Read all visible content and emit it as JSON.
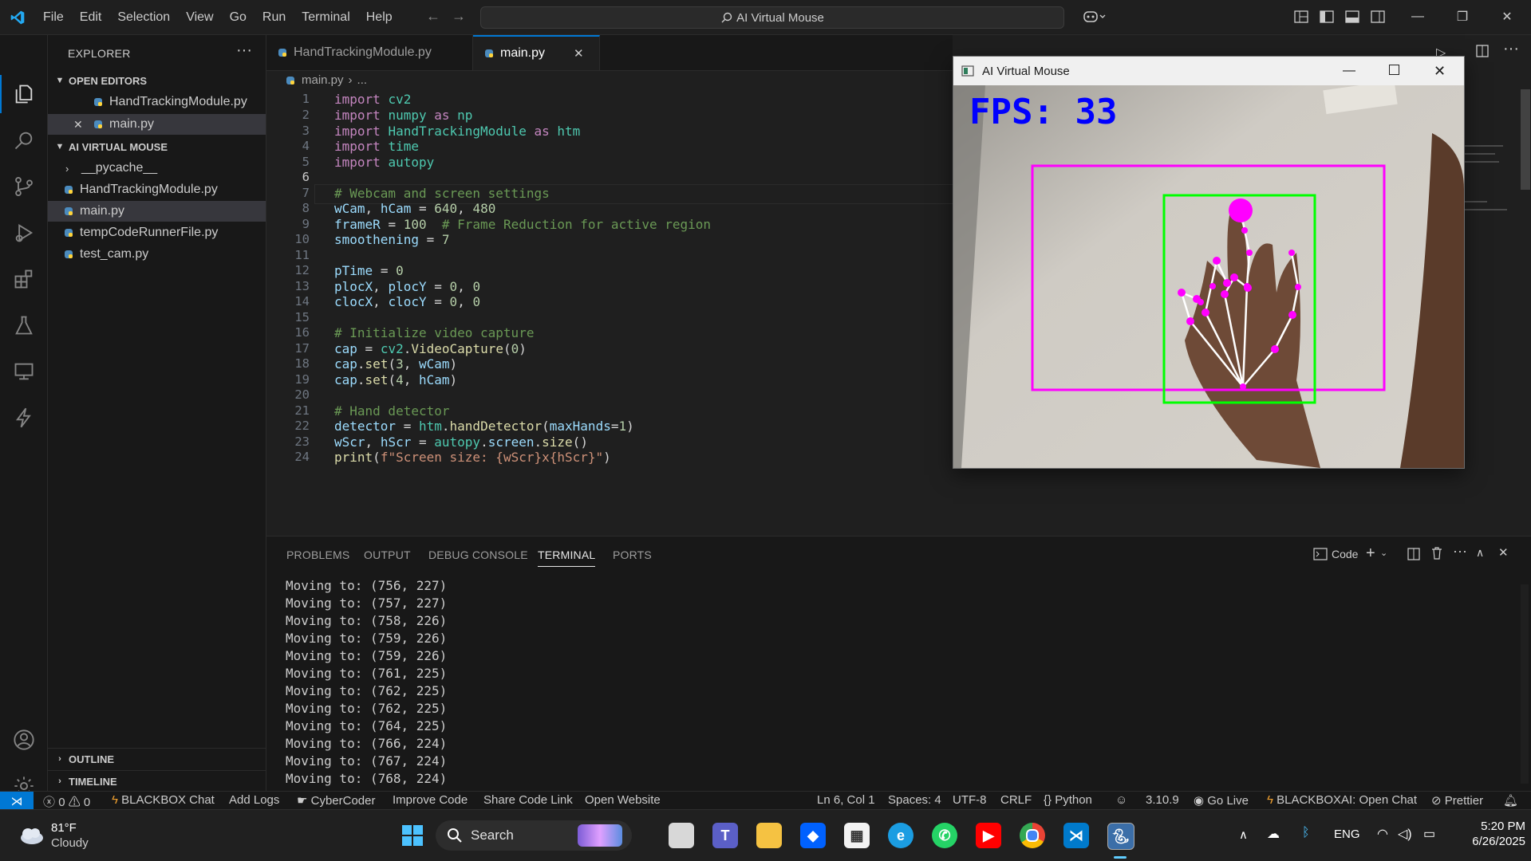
{
  "window": {
    "search_text": "AI Virtual Mouse"
  },
  "menu": [
    "File",
    "Edit",
    "Selection",
    "View",
    "Go",
    "Run",
    "Terminal",
    "Help"
  ],
  "sidebar": {
    "title": "EXPLORER",
    "open_editors_label": "OPEN EDITORS",
    "open_editors": [
      "HandTrackingModule.py",
      "main.py"
    ],
    "project_label": "AI VIRTUAL MOUSE",
    "files": [
      "__pycache__",
      "HandTrackingModule.py",
      "main.py",
      "tempCodeRunnerFile.py",
      "test_cam.py"
    ],
    "outline_label": "OUTLINE",
    "timeline_label": "TIMELINE"
  },
  "tabs": [
    {
      "label": "HandTrackingModule.py"
    },
    {
      "label": "main.py"
    }
  ],
  "breadcrumb": {
    "file": "main.py",
    "rest": "..."
  },
  "editor": {
    "line_numbers": [
      "1",
      "2",
      "3",
      "4",
      "5",
      "6",
      "7",
      "8",
      "9",
      "10",
      "11",
      "12",
      "13",
      "14",
      "15",
      "16",
      "17",
      "18",
      "19",
      "20",
      "21",
      "22",
      "23",
      "24"
    ],
    "lines": [
      "import cv2",
      "import numpy as np",
      "import HandTrackingModule as htm",
      "import time",
      "import autopy",
      "",
      "# Webcam and screen settings",
      "wCam, hCam = 640, 480",
      "frameR = 100  # Frame Reduction for active region",
      "smoothening = 7",
      "",
      "pTime = 0",
      "plocX, plocY = 0, 0",
      "clocX, clocY = 0, 0",
      "",
      "# Initialize video capture",
      "cap = cv2.VideoCapture(0)",
      "cap.set(3, wCam)",
      "cap.set(4, hCam)",
      "",
      "# Hand detector",
      "detector = htm.handDetector(maxHands=1)",
      "wScr, hScr = autopy.screen.size()",
      "print(f\"Screen size: {wScr}x{hScr}\")"
    ]
  },
  "app_window": {
    "title": "AI Virtual Mouse",
    "fps_text": "FPS: 33"
  },
  "panel": {
    "tabs": [
      "PROBLEMS",
      "OUTPUT",
      "DEBUG CONSOLE",
      "TERMINAL",
      "PORTS"
    ],
    "terminal_profile": "Code",
    "terminal_lines": [
      "Moving to: (756, 227)",
      "Moving to: (757, 227)",
      "Moving to: (758, 226)",
      "Moving to: (759, 226)",
      "Moving to: (759, 226)",
      "Moving to: (761, 225)",
      "Moving to: (762, 225)",
      "Moving to: (762, 225)",
      "Moving to: (764, 225)",
      "Moving to: (766, 224)",
      "Moving to: (767, 224)",
      "Moving to: (768, 224)"
    ]
  },
  "statusbar": {
    "errors": "0",
    "warnings": "0",
    "left_items": [
      "BLACKBOX Chat",
      "Add Logs",
      "CyberCoder",
      "Improve Code",
      "Share Code Link",
      "Open Website"
    ],
    "position": "Ln 6, Col 1",
    "spaces": "Spaces: 4",
    "encoding": "UTF-8",
    "eol": "CRLF",
    "language": "Python",
    "python_version": "3.10.9",
    "go_live": "Go Live",
    "blackbox_open": "BLACKBOXAI: Open Chat",
    "prettier": "Prettier"
  },
  "taskbar": {
    "weather_temp": "81°F",
    "weather_desc": "Cloudy",
    "search_label": "Search",
    "language": "ENG",
    "time": "5:20 PM",
    "date": "6/26/2025"
  },
  "colors": {
    "accent": "#0078d4",
    "fps": "#0000ff",
    "frame_box": "#ff00ff",
    "hand_box": "#00ff00"
  }
}
